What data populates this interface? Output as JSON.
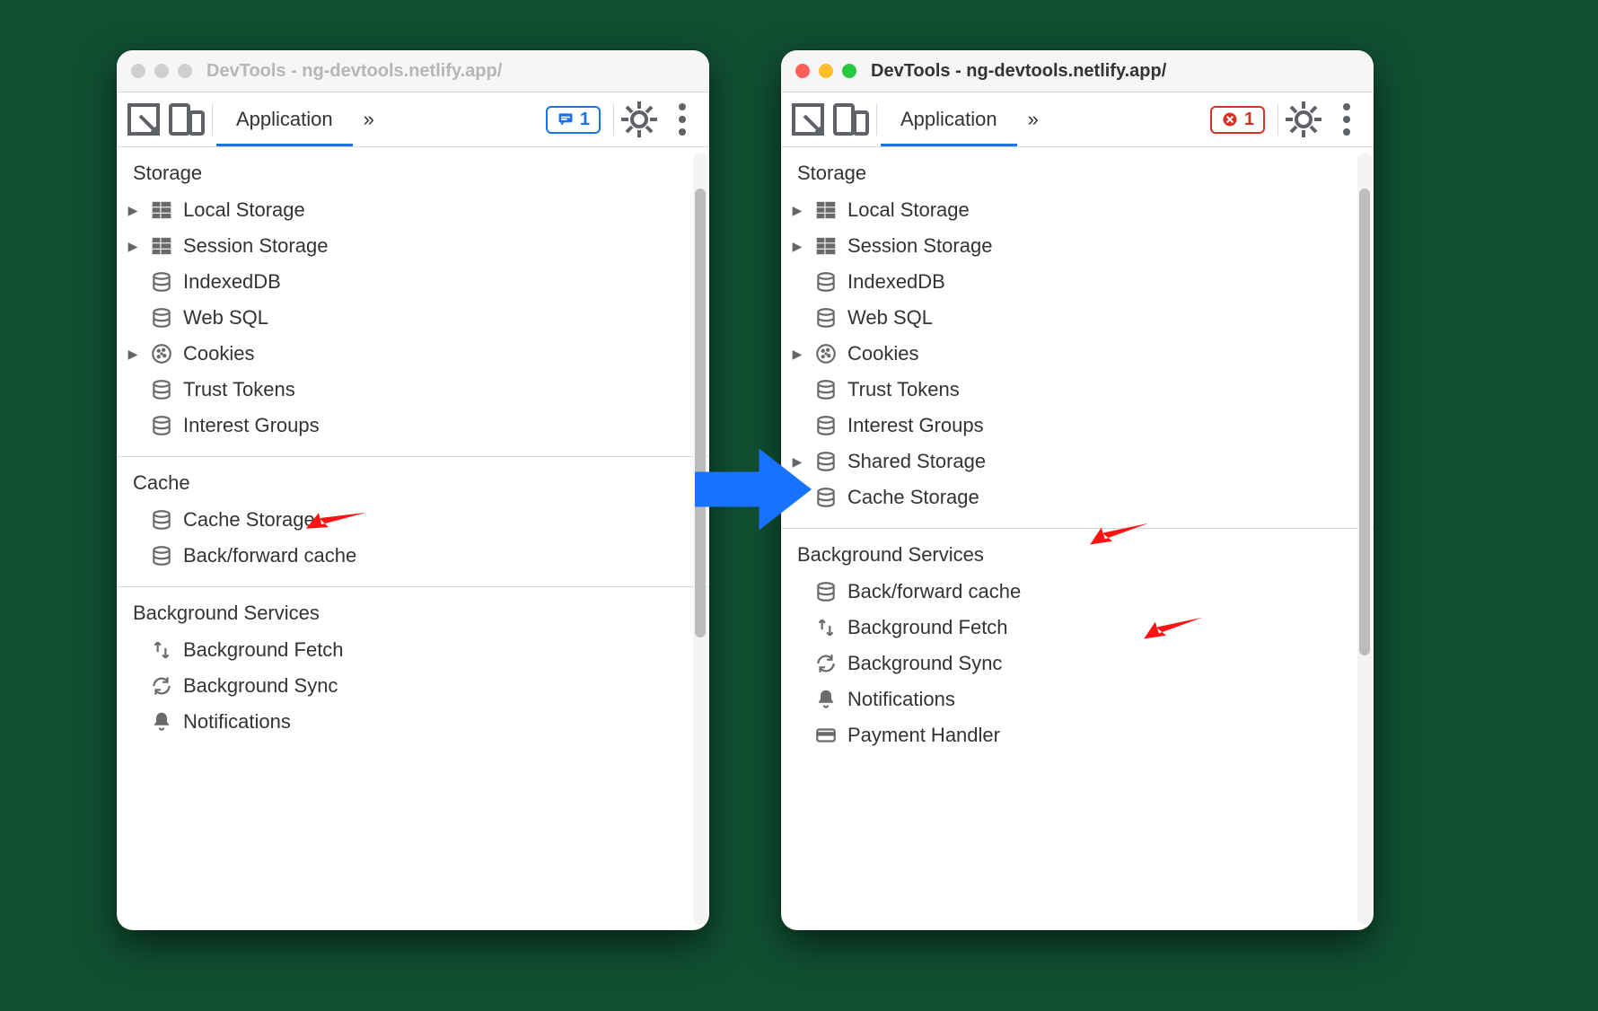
{
  "windows": {
    "left": {
      "active": false,
      "title": "DevTools - ng-devtools.netlify.app/",
      "tab": "Application",
      "badge_count": "1",
      "badge_kind": "blue",
      "sections": [
        {
          "title": "Storage",
          "items": [
            {
              "label": "Local Storage",
              "icon": "grid",
              "expandable": true
            },
            {
              "label": "Session Storage",
              "icon": "grid",
              "expandable": true
            },
            {
              "label": "IndexedDB",
              "icon": "db",
              "expandable": false
            },
            {
              "label": "Web SQL",
              "icon": "db",
              "expandable": false
            },
            {
              "label": "Cookies",
              "icon": "cookie",
              "expandable": true
            },
            {
              "label": "Trust Tokens",
              "icon": "db",
              "expandable": false
            },
            {
              "label": "Interest Groups",
              "icon": "db",
              "expandable": false
            }
          ]
        },
        {
          "title": "Cache",
          "items": [
            {
              "label": "Cache Storage",
              "icon": "db",
              "expandable": false
            },
            {
              "label": "Back/forward cache",
              "icon": "db",
              "expandable": false
            }
          ]
        },
        {
          "title": "Background Services",
          "items": [
            {
              "label": "Background Fetch",
              "icon": "fetch",
              "expandable": false
            },
            {
              "label": "Background Sync",
              "icon": "sync",
              "expandable": false
            },
            {
              "label": "Notifications",
              "icon": "bell",
              "expandable": false
            }
          ]
        }
      ]
    },
    "right": {
      "active": true,
      "title": "DevTools - ng-devtools.netlify.app/",
      "tab": "Application",
      "badge_count": "1",
      "badge_kind": "red",
      "sections": [
        {
          "title": "Storage",
          "items": [
            {
              "label": "Local Storage",
              "icon": "grid",
              "expandable": true
            },
            {
              "label": "Session Storage",
              "icon": "grid",
              "expandable": true
            },
            {
              "label": "IndexedDB",
              "icon": "db",
              "expandable": false
            },
            {
              "label": "Web SQL",
              "icon": "db",
              "expandable": false
            },
            {
              "label": "Cookies",
              "icon": "cookie",
              "expandable": true
            },
            {
              "label": "Trust Tokens",
              "icon": "db",
              "expandable": false
            },
            {
              "label": "Interest Groups",
              "icon": "db",
              "expandable": false
            },
            {
              "label": "Shared Storage",
              "icon": "db",
              "expandable": true
            },
            {
              "label": "Cache Storage",
              "icon": "db",
              "expandable": false
            }
          ]
        },
        {
          "title": "Background Services",
          "items": [
            {
              "label": "Back/forward cache",
              "icon": "db",
              "expandable": false
            },
            {
              "label": "Background Fetch",
              "icon": "fetch",
              "expandable": false
            },
            {
              "label": "Background Sync",
              "icon": "sync",
              "expandable": false
            },
            {
              "label": "Notifications",
              "icon": "bell",
              "expandable": false
            },
            {
              "label": "Payment Handler",
              "icon": "card",
              "expandable": false
            }
          ]
        }
      ]
    }
  }
}
